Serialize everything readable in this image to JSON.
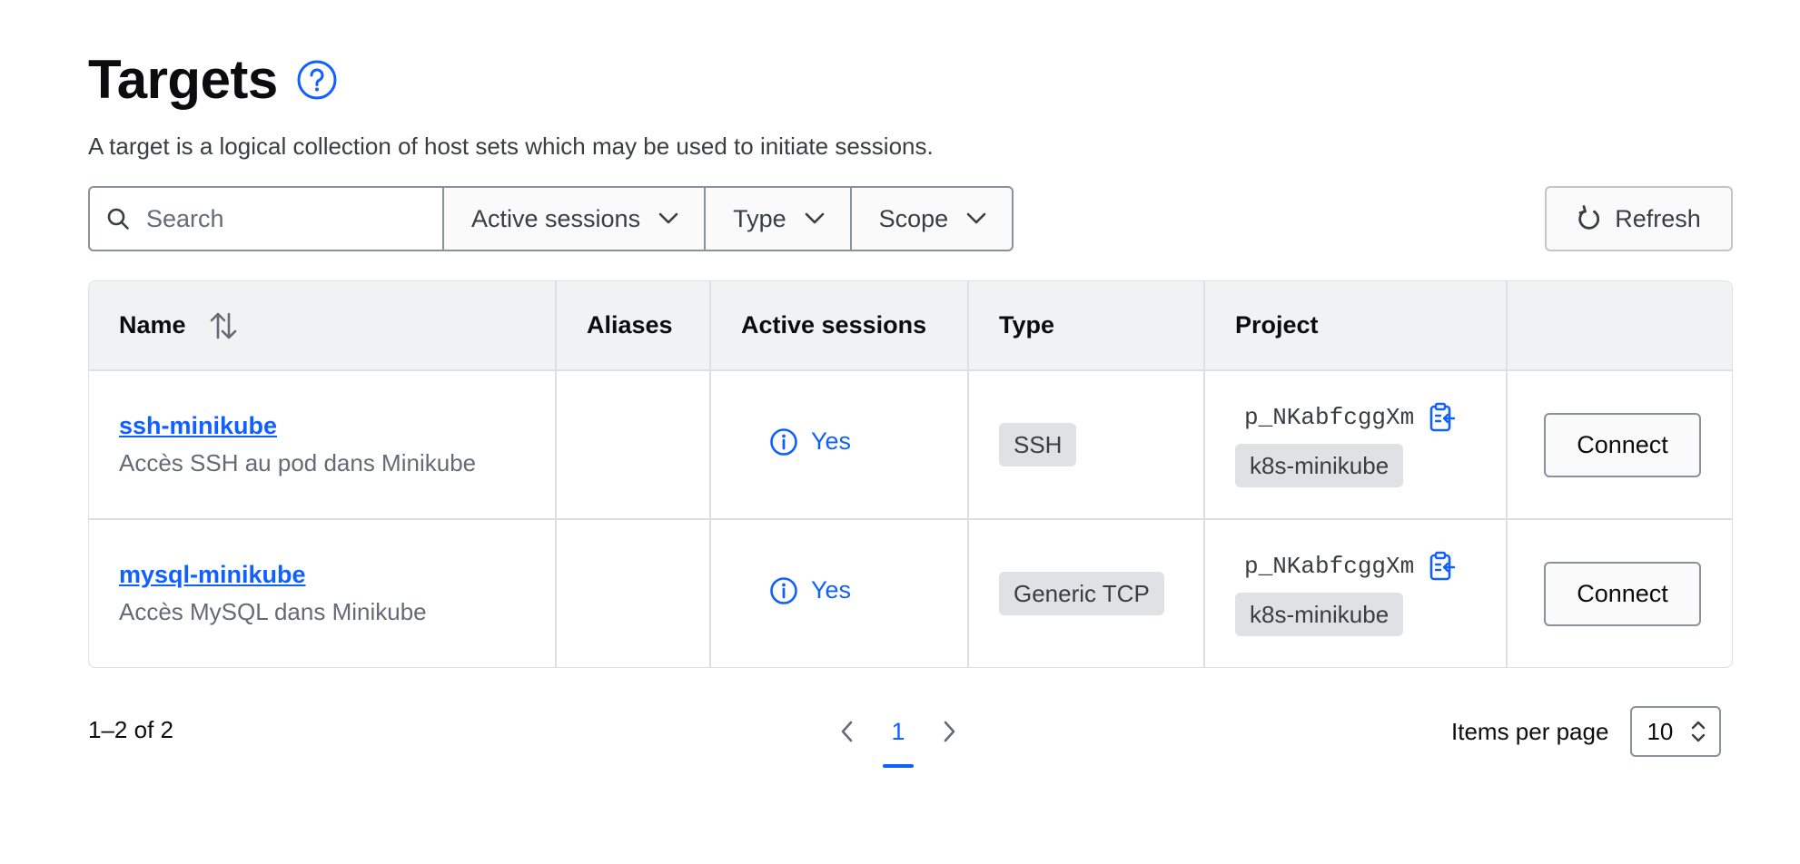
{
  "header": {
    "title": "Targets",
    "description": "A target is a logical collection of host sets which may be used to initiate sessions.",
    "help_icon": "question-circle-icon"
  },
  "toolbar": {
    "search_placeholder": "Search",
    "filters": [
      "Active sessions",
      "Type",
      "Scope"
    ],
    "refresh_label": "Refresh"
  },
  "table": {
    "columns": [
      "Name",
      "Aliases",
      "Active sessions",
      "Type",
      "Project",
      ""
    ],
    "rows": [
      {
        "name": "ssh-minikube",
        "description": "Accès SSH au pod dans Minikube",
        "aliases": "",
        "active_sessions": "Yes",
        "type": "SSH",
        "project_id": "p_NKabfcggXm",
        "project_name": "k8s-minikube",
        "action": "Connect"
      },
      {
        "name": "mysql-minikube",
        "description": "Accès MySQL dans Minikube",
        "aliases": "",
        "active_sessions": "Yes",
        "type": "Generic TCP",
        "project_id": "p_NKabfcggXm",
        "project_name": "k8s-minikube",
        "action": "Connect"
      }
    ]
  },
  "pagination": {
    "range": "1–2 of 2",
    "current_page": "1",
    "items_per_page_label": "Items per page",
    "items_per_page": "10"
  },
  "colors": {
    "accent": "#1060ff",
    "header_bg": "#f1f2f3",
    "badge_bg": "#e0e1e5"
  }
}
